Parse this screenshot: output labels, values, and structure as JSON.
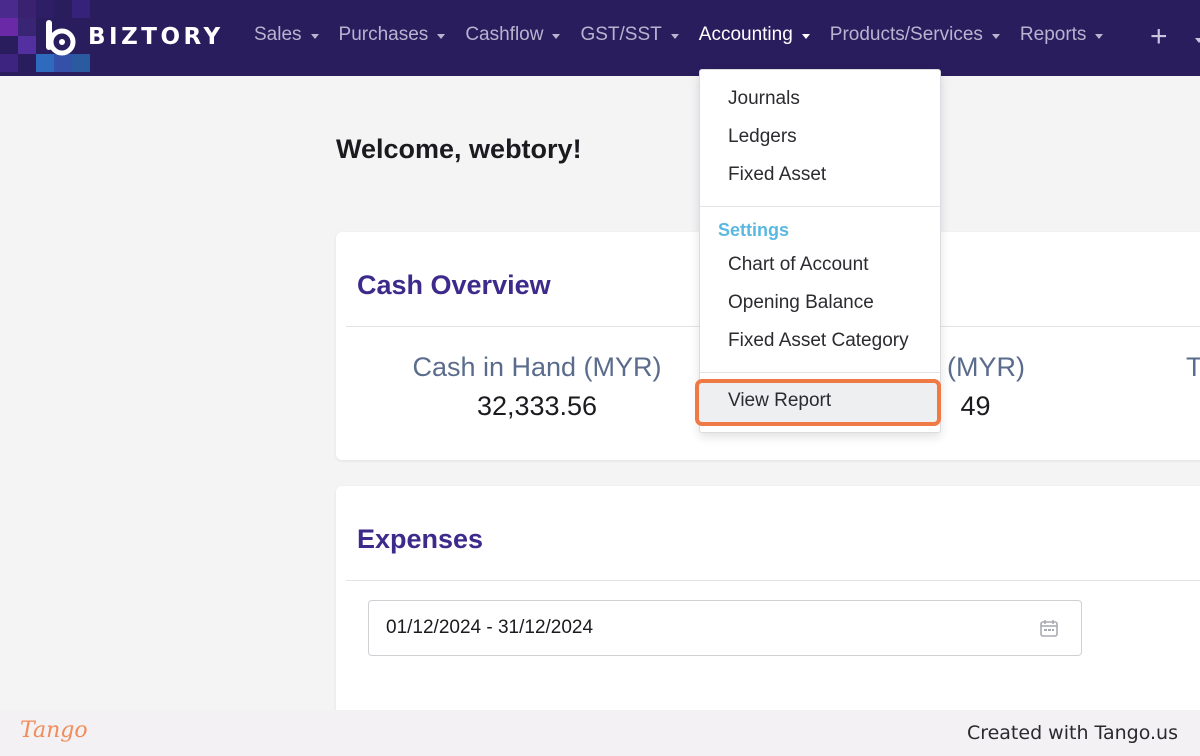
{
  "app": {
    "brand": "BIZTORY"
  },
  "nav": {
    "items": [
      {
        "label": "Sales"
      },
      {
        "label": "Purchases"
      },
      {
        "label": "Cashflow"
      },
      {
        "label": "GST/SST"
      },
      {
        "label": "Accounting"
      },
      {
        "label": "Products/Services"
      },
      {
        "label": "Reports"
      }
    ],
    "active": "Accounting",
    "add_icon": "plus-icon"
  },
  "welcome": "Welcome, webtory!",
  "cash_overview": {
    "title": "Cash Overview",
    "stats": [
      {
        "label": "Cash in Hand (MYR)",
        "value": "32,333.56"
      },
      {
        "label": "k (MYR)",
        "value": "49"
      },
      {
        "label": "T",
        "value": ""
      }
    ]
  },
  "expenses": {
    "title": "Expenses",
    "date_range": "01/12/2024 - 31/12/2024",
    "calendar_icon": "calendar-icon"
  },
  "accounting_menu": {
    "items": [
      "Journals",
      "Ledgers",
      "Fixed Asset"
    ],
    "settings_header": "Settings",
    "settings_items": [
      "Chart of Account",
      "Opening Balance",
      "Fixed Asset Category"
    ],
    "report_item": "View Report"
  },
  "footer": {
    "logo": "Tango",
    "credit": "Created with Tango.us"
  },
  "colors": {
    "nav_bg": "#2a1d5e",
    "card_title": "#3d2a8a",
    "settings_header": "#5bb8e0",
    "highlight": "#f07a45"
  }
}
